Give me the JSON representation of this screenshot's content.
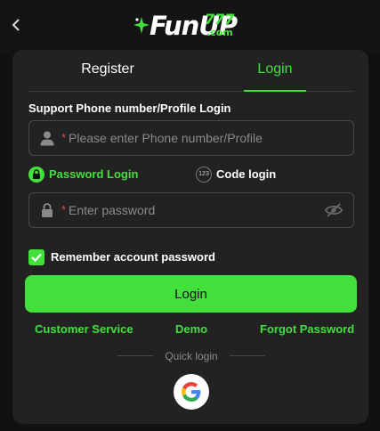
{
  "header": {
    "back_icon": "chevron-left-icon",
    "logo": {
      "main": "FunUP",
      "num": "777",
      "com": ".com"
    }
  },
  "tabs": [
    {
      "label": "Register",
      "active": false
    },
    {
      "label": "Login",
      "active": true
    }
  ],
  "form": {
    "section_label": "Support Phone number/Profile Login",
    "phone": {
      "placeholder": "Please enter Phone number/Profile",
      "value": "",
      "icon": "user-icon",
      "required_mark": "*"
    },
    "modes": [
      {
        "label": "Password Login",
        "icon": "lock-icon",
        "active": true
      },
      {
        "label": "Code login",
        "icon": "code-123-icon",
        "icon_text": "123",
        "active": false
      }
    ],
    "password": {
      "placeholder": "Enter password",
      "value": "",
      "icon": "lock-icon",
      "required_mark": "*",
      "toggle_icon": "eye-off-icon"
    },
    "remember": {
      "label": "Remember account password",
      "checked": true
    },
    "submit_label": "Login"
  },
  "links": {
    "customer_service": "Customer Service",
    "demo": "Demo",
    "forgot": "Forgot Password"
  },
  "quick_login": {
    "label": "Quick login",
    "providers": [
      "google-icon"
    ]
  },
  "colors": {
    "accent": "#43e03d",
    "card": "#222222",
    "background": "#111111",
    "required": "#e04848"
  }
}
